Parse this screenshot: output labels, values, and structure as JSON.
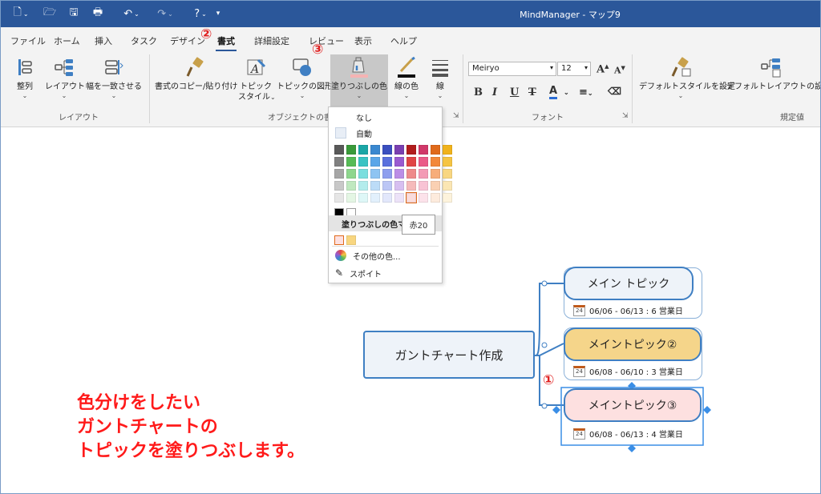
{
  "window": {
    "title": "MindManager - マップ9"
  },
  "tabs": [
    "ファイル",
    "ホーム",
    "挿入",
    "タスク",
    "デザイン",
    "書式",
    "詳細設定",
    "レビュー",
    "表示",
    "ヘルプ"
  ],
  "ribbon": {
    "layout_group": {
      "label": "レイアウト",
      "buttons": [
        "整列",
        "レイアウト",
        "幅を一致させる"
      ]
    },
    "object_format_group": {
      "label": "オブジェクトの書式",
      "buttons": [
        "書式のコピー/貼り付け",
        "トピック",
        "スタイル",
        "トピックの図形",
        "塗りつぶしの色",
        "線の色",
        "線"
      ]
    },
    "font_group": {
      "label": "フォント",
      "font_name": "Meiryo",
      "font_size": "12",
      "grow": "A",
      "shrink": "A",
      "bold": "B",
      "italic": "I",
      "underline": "U",
      "strike": "T",
      "color": "A"
    },
    "defaults_group": {
      "label": "規定値",
      "buttons": [
        "デフォルトスタイルを設定",
        "デフォルトレイアウトの設定"
      ]
    }
  },
  "fill_menu": {
    "none": "なし",
    "auto": "自動",
    "recent_header": "塗りつぶしの色マ",
    "more_colors": "その他の色...",
    "eyedropper": "スポイト",
    "tooltip": "赤20",
    "palette": [
      [
        "#595959",
        "#3a9a3a",
        "#1aa6a6",
        "#3a88d0",
        "#3a4fbf",
        "#7a3fb0",
        "#b11d1d",
        "#d0386a",
        "#e06a1b",
        "#f0b21b"
      ],
      [
        "#808080",
        "#56bb56",
        "#39c3c3",
        "#5aa6e8",
        "#5a70dd",
        "#9a5ad0",
        "#e04545",
        "#ea5a88",
        "#f2883a",
        "#f5c443"
      ],
      [
        "#a6a6a6",
        "#8ed68e",
        "#7adede",
        "#8ec4f2",
        "#8e9eee",
        "#bb8ee6",
        "#ee8a8a",
        "#f39ab5",
        "#f7ad7a",
        "#f8d680"
      ],
      [
        "#c8c8c8",
        "#bfe8bf",
        "#b3ecec",
        "#bcdcf7",
        "#bcc6f5",
        "#d7bff0",
        "#f5baba",
        "#f8c3d4",
        "#fad0b3",
        "#fbe6b3"
      ],
      [
        "#e6e6e6",
        "#e4f6e4",
        "#def7f7",
        "#e2f0fc",
        "#e2e7fb",
        "#ece2f8",
        "#fadcdc",
        "#fce2ea",
        "#fdebdd",
        "#fdf3dc"
      ]
    ],
    "basic": [
      "#000000",
      "#ffffff"
    ],
    "recent": [
      "#fde0e0",
      "#f8d680"
    ]
  },
  "canvas": {
    "annotation": [
      "色分けをしたい",
      "ガントチャートの",
      "トピックを塗りつぶします。"
    ],
    "markers": [
      "①",
      "②",
      "③"
    ],
    "central_topic": "ガントチャート作成",
    "topics": [
      {
        "title": "メイン トピック",
        "fill": "#eef3f9",
        "dates": "06/06 - 06/13 : 6 営業日"
      },
      {
        "title": "メイントピック②",
        "fill": "#f5d58a",
        "dates": "06/08 - 06/10 : 3 営業日"
      },
      {
        "title": "メイントピック③",
        "fill": "#fde0e0",
        "dates": "06/08 - 06/13 : 4 営業日"
      }
    ],
    "calendar_day": "24"
  }
}
